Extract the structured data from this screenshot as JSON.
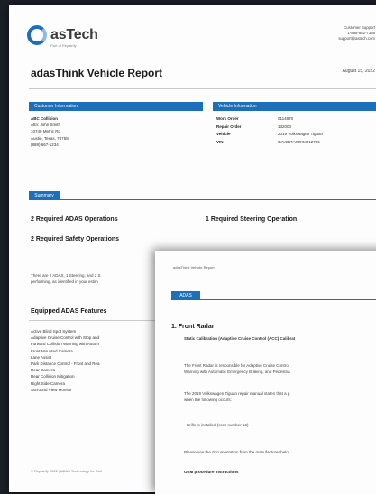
{
  "header": {
    "logo_text": "asTech",
    "logo_tagline": "Part of Repairify",
    "support_title": "Customer Support",
    "support_phone": "1-888-882-7386",
    "support_email": "support@astech.com",
    "report_title": "adasThink Vehicle Report",
    "report_date": "August 15, 2022"
  },
  "customer": {
    "section_label": "Customer Information",
    "name": "ABC Collision",
    "lines": [
      "Attn: John Smith",
      "10740 Metric Rd",
      "Austin, Texas, 78758",
      "(888) 667-1234"
    ]
  },
  "vehicle": {
    "section_label": "Vehicle Information",
    "rows": [
      {
        "label": "Work Order",
        "value": "0114870"
      },
      {
        "label": "Repair Order",
        "value": "132000"
      },
      {
        "label": "Vehicle",
        "value": "2019 Volkswagen Tiguan"
      },
      {
        "label": "VIN",
        "value": "3VV2B7AX0KM012786"
      }
    ]
  },
  "summary": {
    "tab_label": "Summary",
    "adas_ops": "2 Required ADAS Operations",
    "steering_op": "1 Required Steering Operation",
    "safety_ops": "2 Required Safety Operations",
    "paragraph": [
      "There are 2 ADAS, 1 Steering, and 2 S",
      "performing, as identified in your estim"
    ]
  },
  "features": {
    "heading": "Equipped ADAS Features",
    "items": [
      "Active Blind Spot System",
      "Adaptive Cruise Control with Stop and",
      "Forward Collision Warning with Autom",
      "Front-Mounted Camera",
      "Lane Assist",
      "Park Distance Control - Front and Rea",
      "Rear Camera",
      "Rear Collision Mitigation",
      "Right Side Camera",
      "Surround View Monitor"
    ],
    "footer": "© Repairify 2022  |  ADAS Technology for Coll"
  },
  "overlay": {
    "page_header": "adasThink Vehicle Report",
    "tab_label": "ADAS",
    "item_title": "1. Front Radar",
    "calibration": "Static Calibration (Adaptive Cruise Control (ACC) Calibrat",
    "p1": [
      "The Front Radar is responsible for Adaptive Cruise Control",
      "Warning with Automatic Emergency Braking, and Pedestria"
    ],
    "p2": [
      "The 2019 Volkswagen Tiguan repair manual states that a p",
      "when the following occurs:"
    ],
    "p3": "- Grille is installed (cccc number 16)",
    "p4": "Please see the documentation from the manufacturer belo",
    "oem": "OEM procedure instructions"
  }
}
